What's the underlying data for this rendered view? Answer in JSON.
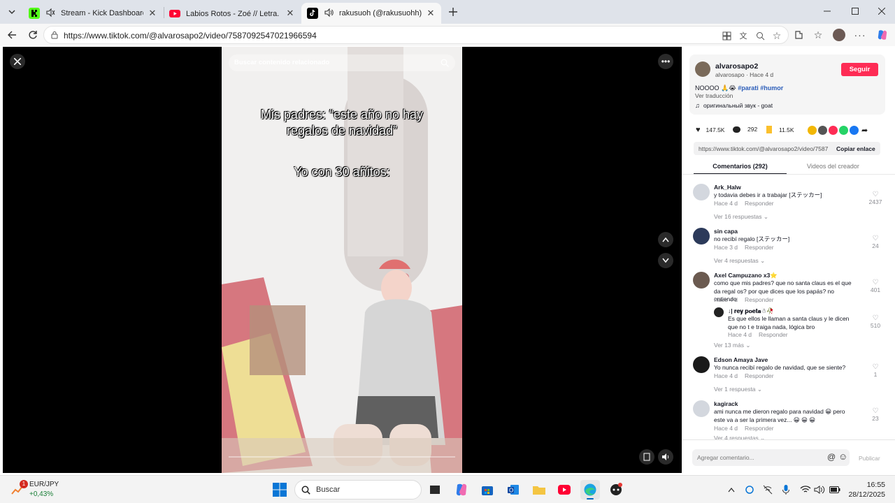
{
  "browser": {
    "tabs": [
      {
        "title": "Stream - Kick Dashboard",
        "icon": "kick-icon",
        "active": false
      },
      {
        "title": "Labios Rotos - Zoé // Letra. ♡ - Yo",
        "icon": "youtube-icon",
        "active": false
      },
      {
        "title": "rakusuoh (@rakusuohh) | TikT",
        "icon": "tiktok-icon",
        "active": true
      }
    ],
    "url": "https://www.tiktok.com/@alvarosapo2/video/7587092547021966594"
  },
  "video": {
    "search_placeholder": "Buscar contenido relacionado",
    "caption_line1": "Mis padres: “este año no hay",
    "caption_line2": "regalos de navidad”",
    "caption_line3": "Yo con 30 añitos:"
  },
  "post": {
    "username": "alvarosapo2",
    "subline": "alvarosapo · Hace 4 d",
    "follow_label": "Seguir",
    "description": "NOOOO 🙏😭",
    "hashtags": "#parati #humor",
    "translate": "Ver traducción",
    "sound": "оригинальный звук - goat",
    "likes": "147.5K",
    "comments_count": "292",
    "saves": "11.5K",
    "link": "https://www.tiktok.com/@alvarosapo2/video/7587...",
    "copy_label": "Copiar enlace",
    "tab_comments": "Comentarios (292)",
    "tab_creator": "Videos del creador"
  },
  "comments": [
    {
      "user": "Ark_Halw",
      "text": "y todavia debes ir a trabajar [ステッカー]",
      "time": "Hace 4 d",
      "reply": "Responder",
      "likes": "2437",
      "more": "Ver 16 respuestas"
    },
    {
      "user": "sin capa",
      "text": "no recibí regalo [ステッカー]",
      "time": "Hace 3 d",
      "reply": "Responder",
      "likes": "24",
      "more": "Ver 4 respuestas"
    },
    {
      "user": "Axel Campuzano x3⭐",
      "text": "como que mis padres? que no santa claus es el que da regal os? por que dices que los papás? no entiendo",
      "time": "Hace 4 d",
      "reply": "Responder",
      "likes": "401"
    },
    {
      "user": "↓| 𝐫𝐞𝐲 𝐩𝐨𝐞𝐭𝐚☃🥀",
      "text": "Es que ellos le llaman a santa claus y le dicen que no t e traiga nada, lógica bro",
      "time": "Hace 4 d",
      "reply": "Responder",
      "likes": "510",
      "more": "Ver 13 más"
    },
    {
      "user": "Edson Amaya Jave",
      "text": "Yo nunca recibí regalo de navidad, que se siente?",
      "time": "Hace 4 d",
      "reply": "Responder",
      "likes": "1",
      "more": "Ver 1 respuesta"
    },
    {
      "user": "kagirack",
      "text": "ami nunca me dieron regalo para navidad 😀 pero este va a ser la primera vez... 😀 😀 😀",
      "time": "Hace 4 d",
      "reply": "Responder",
      "likes": "23",
      "more": "Ver 4 respuestas"
    }
  ],
  "comment_input": {
    "placeholder": "Agregar comentario...",
    "publish": "Publicar"
  },
  "taskbar": {
    "ticker": "EUR/JPY",
    "ticker_change": "+0,43%",
    "badge": "1",
    "search_placeholder": "Buscar",
    "time": "16:55",
    "date": "28/12/2025"
  }
}
